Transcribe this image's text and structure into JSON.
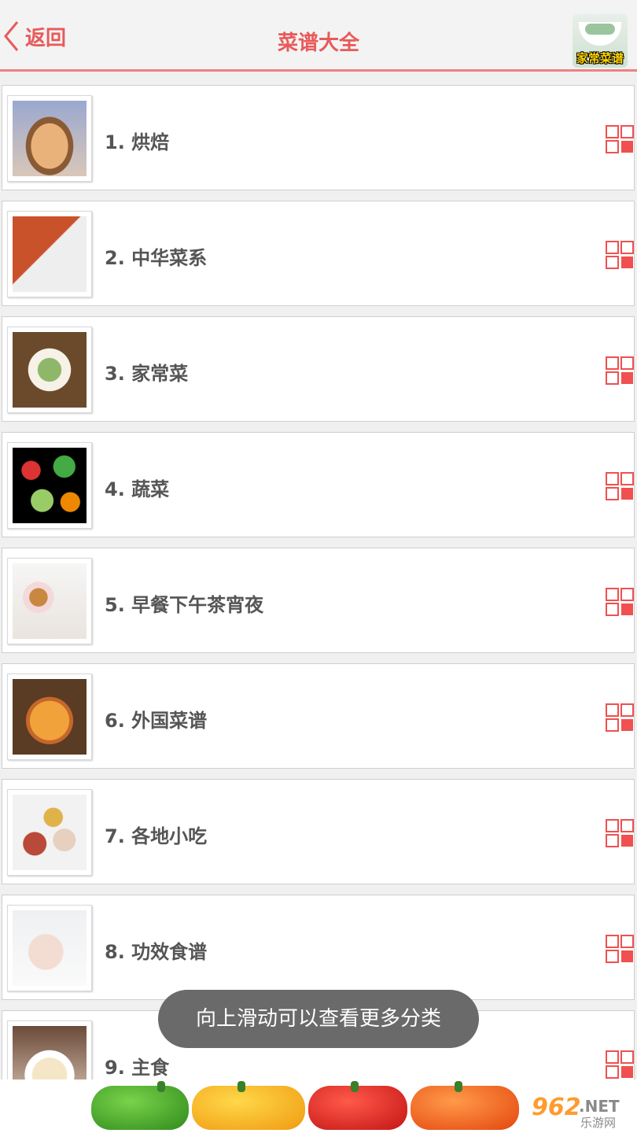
{
  "header": {
    "back_label": "返回",
    "title": "菜谱大全",
    "badge_text": "家常菜谱"
  },
  "categories": [
    {
      "label": "1. 烘焙",
      "icon": "baking-photo"
    },
    {
      "label": "2. 中华菜系",
      "icon": "chinese-cuisine-photo"
    },
    {
      "label": "3. 家常菜",
      "icon": "home-dish-photo"
    },
    {
      "label": "4. 蔬菜",
      "icon": "vegetables-photo"
    },
    {
      "label": "5. 早餐下午茶宵夜",
      "icon": "breakfast-tea-photo"
    },
    {
      "label": "6. 外国菜谱",
      "icon": "pizza-photo"
    },
    {
      "label": "7. 各地小吃",
      "icon": "snacks-photo"
    },
    {
      "label": "8. 功效食谱",
      "icon": "fitness-photo"
    },
    {
      "label": "9. 主食",
      "icon": "staple-food-photo"
    }
  ],
  "toast": "向上滑动可以查看更多分类",
  "ad": {
    "logo_main": "962",
    "logo_suffix": ".NET",
    "logo_sub": "乐游网"
  },
  "colors": {
    "accent": "#e85a5a",
    "header_bg": "#f3f3f3",
    "grid_icon": "#f05050"
  }
}
